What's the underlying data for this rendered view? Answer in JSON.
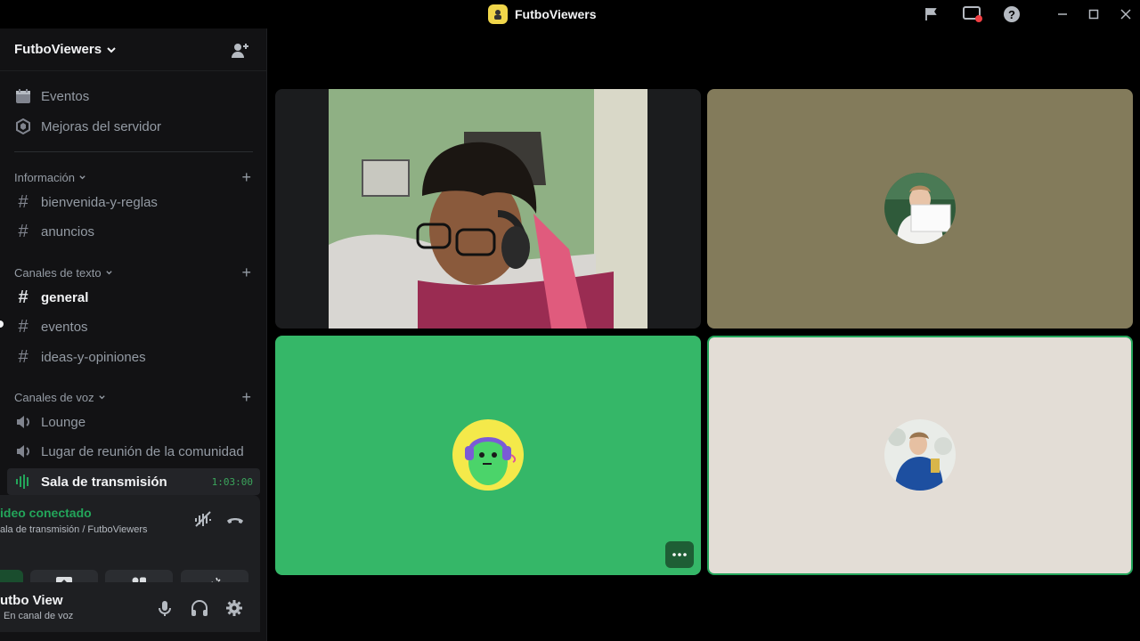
{
  "window": {
    "title": "FutboViewers",
    "controls": [
      "flag-icon",
      "screen-record-icon",
      "help-icon",
      "minimize-icon",
      "maximize-icon",
      "close-icon"
    ]
  },
  "server": {
    "name": "FutboViewers"
  },
  "sidebar": {
    "top_items": [
      {
        "label": "Eventos",
        "icon": "calendar-icon"
      },
      {
        "label": "Mejoras del servidor",
        "icon": "boost-icon"
      }
    ],
    "categories": [
      {
        "label": "Información",
        "channels": [
          {
            "label": "bienvenida-y-reglas",
            "icon": "hash-icon"
          },
          {
            "label": "anuncios",
            "icon": "hash-icon"
          }
        ]
      },
      {
        "label": "Canales de texto",
        "channels": [
          {
            "label": "general",
            "icon": "hash-icon"
          },
          {
            "label": "eventos",
            "icon": "hash-icon"
          },
          {
            "label": "ideas-y-opiniones",
            "icon": "hash-icon"
          }
        ]
      },
      {
        "label": "Canales de voz",
        "channels": [
          {
            "label": "Lounge",
            "icon": "speaker-icon"
          },
          {
            "label": "Lugar de reunión de la comunidad",
            "icon": "speaker-icon"
          },
          {
            "label": "Sala de transmisión",
            "icon": "stage-icon",
            "timer": "1:03:00"
          }
        ]
      }
    ]
  },
  "voice": {
    "status": "ideo conectado",
    "location": "ala de transmisión / FutboViewers"
  },
  "user": {
    "name": "utbo View",
    "status": "En canal de voz"
  },
  "colors": {
    "connected": "#23a55a",
    "tile_green": "#35b768",
    "tile_olive": "#837b5b",
    "tile_beige": "#e3ddd6"
  }
}
